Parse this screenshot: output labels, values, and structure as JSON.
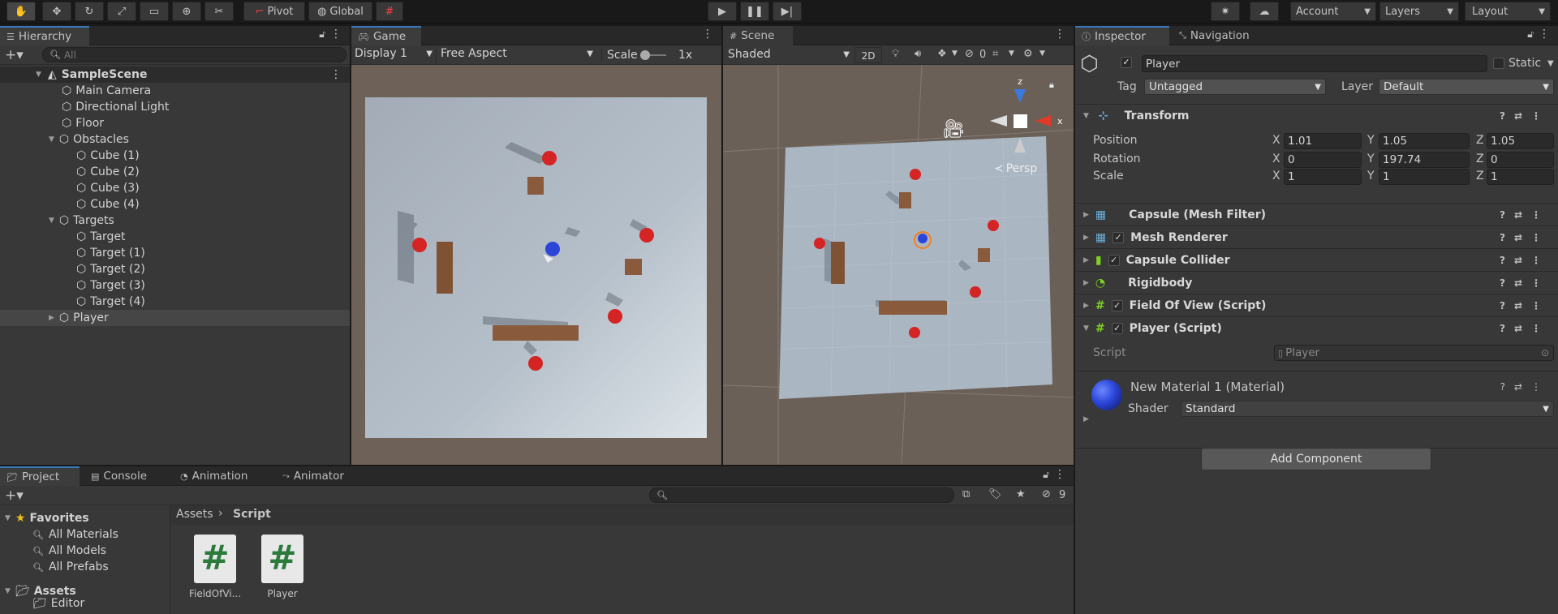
{
  "toolbar": {
    "pivot": "Pivot",
    "global": "Global",
    "account": "Account",
    "layers": "Layers",
    "layout": "Layout"
  },
  "hierarchy": {
    "tab": "Hierarchy",
    "search_placeholder": "All",
    "items": [
      {
        "label": "SampleScene"
      },
      {
        "label": "Main Camera"
      },
      {
        "label": "Directional Light"
      },
      {
        "label": "Floor"
      },
      {
        "label": "Obstacles"
      },
      {
        "label": "Cube (1)"
      },
      {
        "label": "Cube (2)"
      },
      {
        "label": "Cube (3)"
      },
      {
        "label": "Cube (4)"
      },
      {
        "label": "Targets"
      },
      {
        "label": "Target"
      },
      {
        "label": "Target (1)"
      },
      {
        "label": "Target (2)"
      },
      {
        "label": "Target (3)"
      },
      {
        "label": "Target (4)"
      },
      {
        "label": "Player"
      }
    ]
  },
  "game": {
    "tab": "Game",
    "display": "Display 1",
    "aspect": "Free Aspect",
    "scale_label": "Scale",
    "scale_value": "1x"
  },
  "scene": {
    "tab": "Scene",
    "shading": "Shaded",
    "mode2d": "2D",
    "hidden_count": "0",
    "persp": "Persp",
    "gizmo_z": "z",
    "gizmo_x": "x"
  },
  "inspector": {
    "tab": "Inspector",
    "nav_tab": "Navigation",
    "object_name": "Player",
    "static_label": "Static",
    "tag_label": "Tag",
    "tag_value": "Untagged",
    "layer_label": "Layer",
    "layer_value": "Default",
    "transform": {
      "title": "Transform",
      "position_label": "Position",
      "rotation_label": "Rotation",
      "scale_label": "Scale",
      "axis_x": "X",
      "axis_y": "Y",
      "axis_z": "Z",
      "position": {
        "x": "1.01",
        "y": "1.05",
        "z": "1.05"
      },
      "rotation": {
        "x": "0",
        "y": "197.74",
        "z": "0"
      },
      "scale": {
        "x": "1",
        "y": "1",
        "z": "1"
      }
    },
    "components": [
      {
        "title": "Capsule (Mesh Filter)"
      },
      {
        "title": "Mesh Renderer"
      },
      {
        "title": "Capsule Collider"
      },
      {
        "title": "Rigidbody"
      },
      {
        "title": "Field Of View (Script)"
      },
      {
        "title": "Player (Script)"
      }
    ],
    "script_label": "Script",
    "script_value": "Player",
    "material_name": "New Material 1 (Material)",
    "shader_label": "Shader",
    "shader_value": "Standard",
    "add_component": "Add Component"
  },
  "project": {
    "tabs": [
      "Project",
      "Console",
      "Animation",
      "Animator"
    ],
    "hidden_count": "9",
    "favorites": "Favorites",
    "fav_items": [
      "All Materials",
      "All Models",
      "All Prefabs"
    ],
    "assets": "Assets",
    "assets_child": "Editor",
    "breadcrumb": [
      "Assets",
      "Script"
    ],
    "files": [
      "FieldOfVi...",
      "Player"
    ]
  },
  "colors": {
    "accent": "#3a79bb",
    "selection": "#464646",
    "panel": "#383838",
    "target_red": "#d42424",
    "player_blue": "#2b45d8",
    "obstacle_brown": "#8a5a3c"
  }
}
